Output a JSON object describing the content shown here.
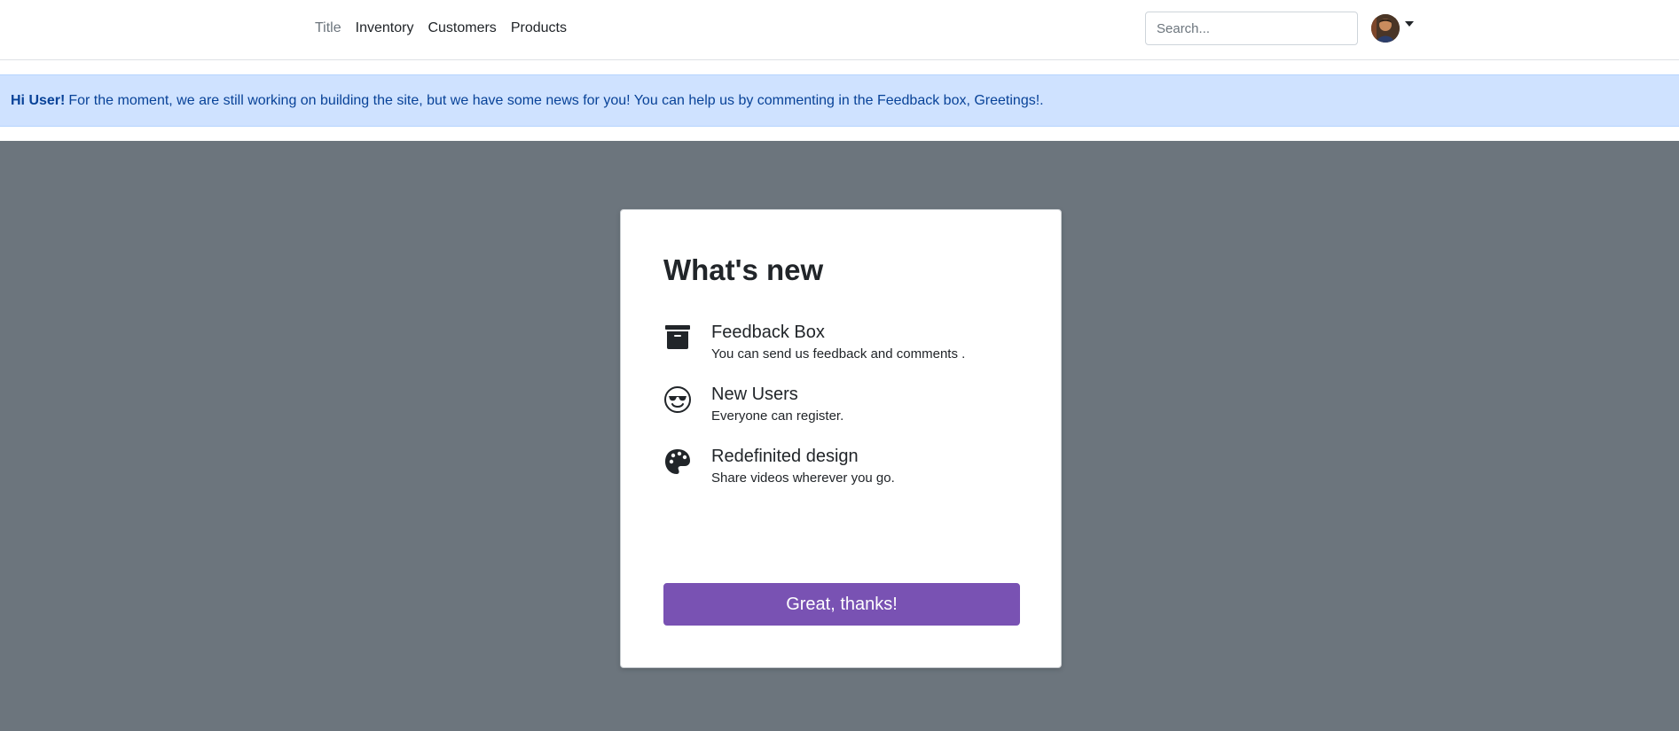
{
  "navbar": {
    "brand": "Title",
    "links": [
      "Inventory",
      "Customers",
      "Products"
    ],
    "search_placeholder": "Search..."
  },
  "alert": {
    "greeting": "Hi User!",
    "message": "For the moment, we are still working on building the site, but we have some news for you! You can help us by commenting in the Feedback box, Greetings!."
  },
  "modal": {
    "title": "What's new",
    "features": [
      {
        "icon": "archive-icon",
        "title": "Feedback Box",
        "text": "You can send us feedback and comments ."
      },
      {
        "icon": "sunglasses-smiley-icon",
        "title": "New Users",
        "text": "Everyone can register."
      },
      {
        "icon": "palette-icon",
        "title": "Redefinited design",
        "text": "Share videos wherever you go."
      }
    ],
    "button_label": "Great, thanks!"
  },
  "colors": {
    "alert_bg": "#cfe2ff",
    "alert_text": "#084298",
    "backdrop": "#6c757d",
    "primary_button": "#7952b3"
  }
}
